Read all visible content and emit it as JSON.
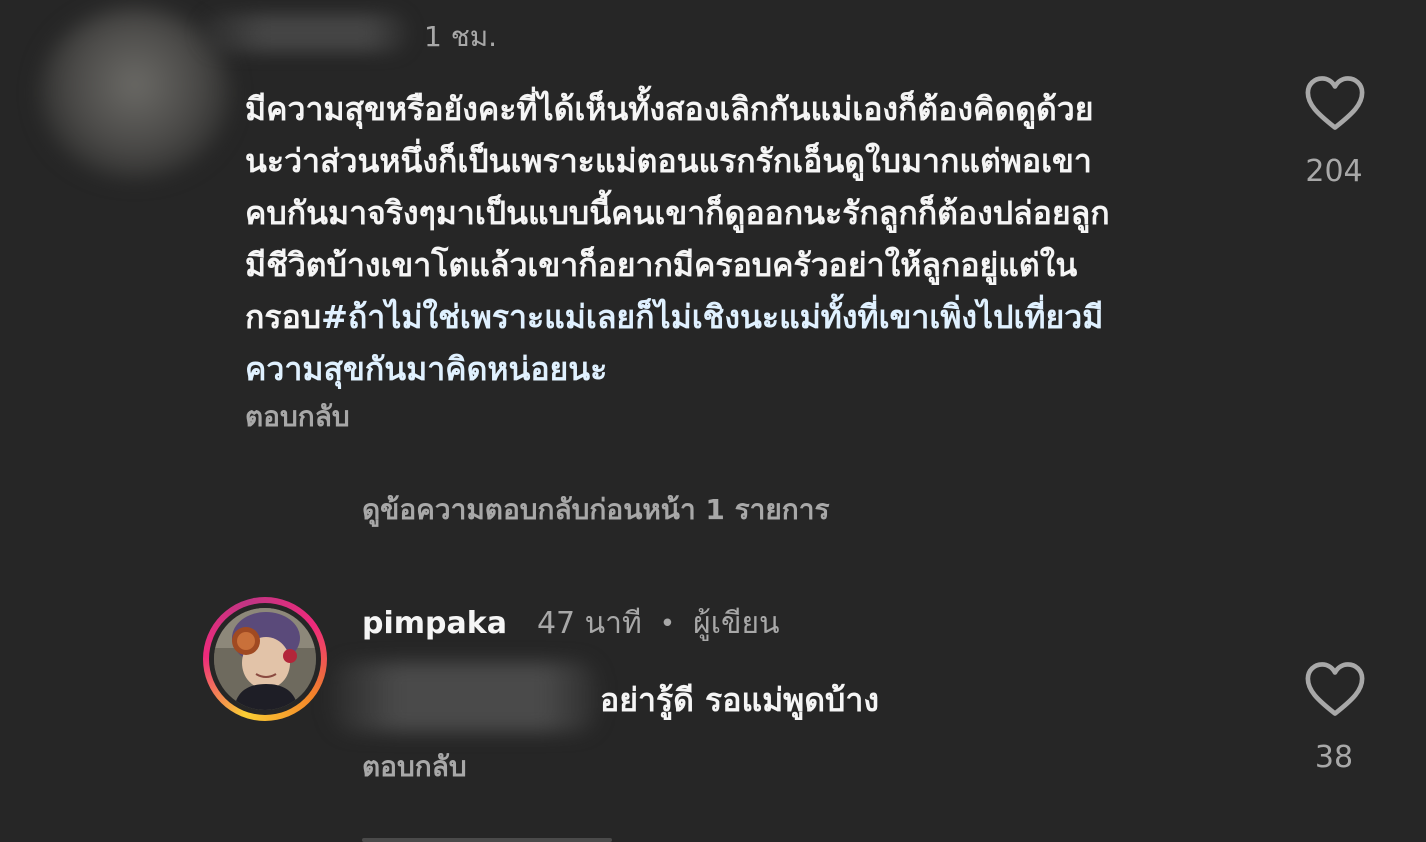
{
  "comment": {
    "time": "1 ชม.",
    "text_lines": [
      "มีความสุขหรือยังคะที่ได้เห็นทั้งสองเลิกกันแม่เองก็ต้องคิดดูด้วย",
      "นะว่าส่วนหนึ่งก็เป็นเพราะแม่ตอนแรกรักเอ็นดูใบมากแต่พอเขา",
      "คบกันมาจริงๆมาเป็นแบบนี้คนเขาก็ดูออกนะรักลูกก็ต้องปล่อยลูก",
      "มีชีวิตบ้างเขาโตแล้วเขาก็อยากมีครอบครัวอย่าให้ลูกอยู่แต่ใน",
      "กรอบ",
      "#ถ้าไม่ใช่เพราะแม่เลยก็ไม่เชิงนะแม่ทั้งที่เขาเพิ่งไปเที่ยวมี",
      "ความสุขกันมาคิดหน่อยนะ"
    ],
    "reply_label": "ตอบกลับ",
    "like_count": "204",
    "icon": "heart-outline-icon"
  },
  "view_previous": "ดูข้อความตอบกลับก่อนหน้า 1 รายการ",
  "reply": {
    "username": "pimpaka",
    "time": "47 นาที",
    "separator": "•",
    "badge": "ผู้เขียน",
    "text": "อย่ารู้ดี  รอแม่พูดบ้าง",
    "reply_label": "ตอบกลับ",
    "like_count": "38",
    "icon": "heart-outline-icon"
  },
  "colors": {
    "background": "#262626",
    "primary_text": "#f5f5f5",
    "secondary_text": "#a8a8a8",
    "hashtag": "#e0f1ff"
  }
}
